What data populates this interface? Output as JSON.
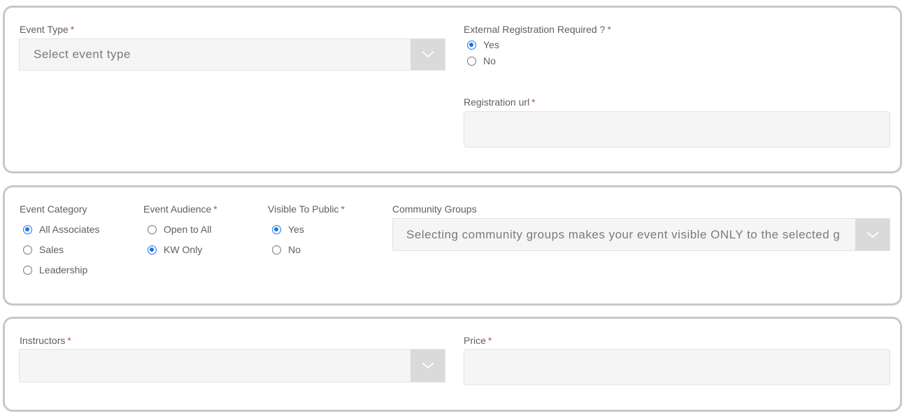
{
  "panel1": {
    "event_type": {
      "label": "Event Type",
      "required": "*",
      "placeholder": "Select event type"
    },
    "external_registration": {
      "label": "External Registration Required ?",
      "required": "*",
      "options": [
        {
          "label": "Yes",
          "selected": true
        },
        {
          "label": "No",
          "selected": false
        }
      ]
    },
    "registration_url": {
      "label": "Registration url",
      "required": "*",
      "value": ""
    }
  },
  "panel2": {
    "event_category": {
      "label": "Event Category",
      "options": [
        {
          "label": "All Associates",
          "selected": true
        },
        {
          "label": "Sales",
          "selected": false
        },
        {
          "label": "Leadership",
          "selected": false
        }
      ]
    },
    "event_audience": {
      "label": "Event Audience",
      "required": "*",
      "options": [
        {
          "label": "Open to All",
          "selected": false
        },
        {
          "label": "KW Only",
          "selected": true
        }
      ]
    },
    "visible_to_public": {
      "label": "Visible To Public",
      "required": "*",
      "options": [
        {
          "label": "Yes",
          "selected": true
        },
        {
          "label": "No",
          "selected": false
        }
      ]
    },
    "community_groups": {
      "label": "Community Groups",
      "placeholder": "Selecting community groups makes your event visible ONLY to the selected g"
    }
  },
  "panel3": {
    "instructors": {
      "label": "Instructors",
      "required": "*",
      "value": ""
    },
    "price": {
      "label": "Price",
      "required": "*",
      "value": ""
    }
  },
  "colors": {
    "accent": "#1a73e8",
    "required": "#b5543f",
    "border": "#c8c8c8",
    "field_bg": "#f5f5f5",
    "arrow_bg": "#dadada"
  }
}
